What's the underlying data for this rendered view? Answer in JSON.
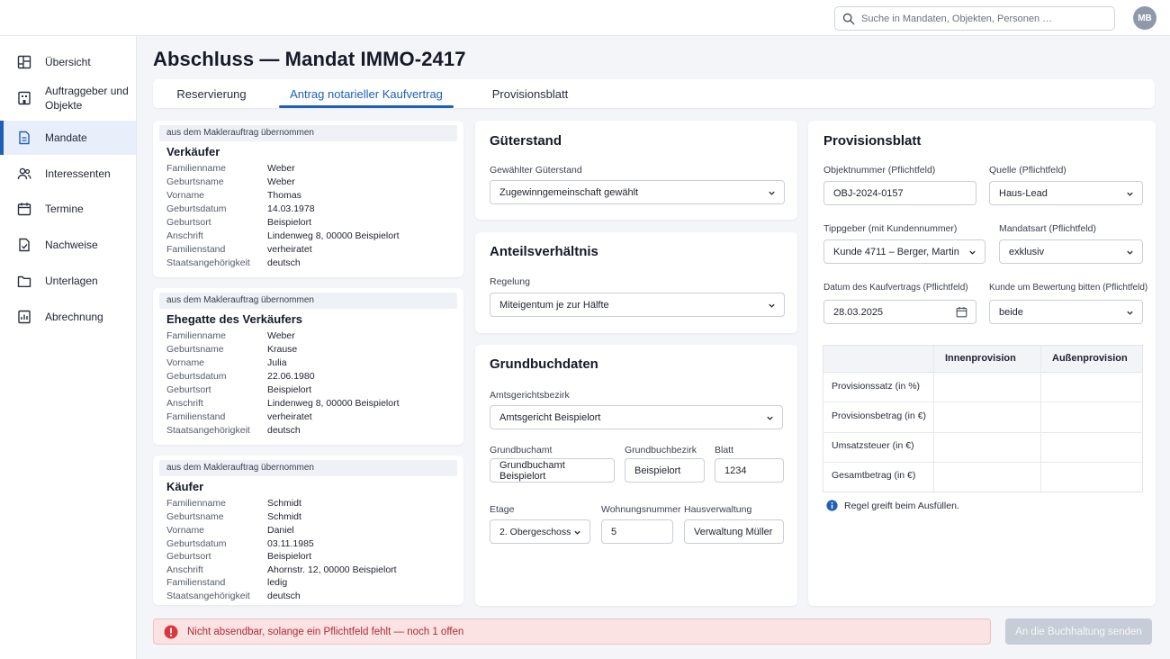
{
  "search": {
    "placeholder": "Suche in Mandaten, Objekten, Personen …"
  },
  "user": {
    "initials": "MB"
  },
  "sidebar": {
    "items": [
      {
        "label": "Übersicht",
        "icon": "grid-icon"
      },
      {
        "label": "Auftraggeber und Objekte",
        "icon": "building-icon"
      },
      {
        "label": "Mandate",
        "icon": "document-icon",
        "active": true
      },
      {
        "label": "Interessenten",
        "icon": "people-icon"
      },
      {
        "label": "Termine",
        "icon": "calendar-icon"
      },
      {
        "label": "Nachweise",
        "icon": "file-check-icon"
      },
      {
        "label": "Unterlagen",
        "icon": "folder-icon"
      },
      {
        "label": "Abrechnung",
        "icon": "receipt-icon"
      }
    ]
  },
  "page": {
    "title": "Abschluss — Mandat IMMO-2417"
  },
  "tabs": [
    {
      "label": "Reservierung"
    },
    {
      "label": "Antrag notarieller Kaufvertrag",
      "active": true
    },
    {
      "label": "Provisionsblatt"
    }
  ],
  "persons": [
    {
      "banner": "aus dem Maklerauftrag übernommen",
      "title": "Verkäufer",
      "rows": [
        [
          "Familienname",
          "Weber"
        ],
        [
          "Geburtsname",
          "Weber"
        ],
        [
          "Vorname",
          "Thomas"
        ],
        [
          "Geburtsdatum",
          "14.03.1978"
        ],
        [
          "Geburtsort",
          "Beispielort"
        ],
        [
          "Anschrift",
          "Lindenweg 8, 00000 Beispielort"
        ],
        [
          "Familienstand",
          "verheiratet"
        ],
        [
          "Staatsangehörigkeit",
          "deutsch"
        ]
      ]
    },
    {
      "banner": "aus dem Maklerauftrag übernommen",
      "title": "Ehegatte des Verkäufers",
      "rows": [
        [
          "Familienname",
          "Weber"
        ],
        [
          "Geburtsname",
          "Krause"
        ],
        [
          "Vorname",
          "Julia"
        ],
        [
          "Geburtsdatum",
          "22.06.1980"
        ],
        [
          "Geburtsort",
          "Beispielort"
        ],
        [
          "Anschrift",
          "Lindenweg 8, 00000 Beispielort"
        ],
        [
          "Familienstand",
          "verheiratet"
        ],
        [
          "Staatsangehörigkeit",
          "deutsch"
        ]
      ]
    },
    {
      "banner": "aus dem Maklerauftrag übernommen",
      "title": "Käufer",
      "rows": [
        [
          "Familienname",
          "Schmidt"
        ],
        [
          "Geburtsname",
          "Schmidt"
        ],
        [
          "Vorname",
          "Daniel"
        ],
        [
          "Geburtsdatum",
          "03.11.1985"
        ],
        [
          "Geburtsort",
          "Beispielort"
        ],
        [
          "Anschrift",
          "Ahornstr. 12, 00000 Beispielort"
        ],
        [
          "Familienstand",
          "ledig"
        ],
        [
          "Staatsangehörigkeit",
          "deutsch"
        ]
      ]
    }
  ],
  "gueterstand": {
    "title": "Güterstand",
    "label": "Gewählter Güterstand",
    "value": "Zugewinngemeinschaft gewählt"
  },
  "anteil": {
    "title": "Anteilsverhältnis",
    "label": "Regelung",
    "value": "Miteigentum je zur Hälfte"
  },
  "grundbuch": {
    "title": "Grundbuchdaten",
    "amtsgericht_label": "Amtsgerichtsbezirk",
    "amtsgericht_value": "Amtsgericht Beispielort",
    "grundbuchamt_label": "Grundbuchamt",
    "grundbuchamt_value": "Grundbuchamt Beispielort",
    "bezirk_label": "Grundbuchbezirk",
    "bezirk_value": "Beispielort",
    "blatt_label": "Blatt",
    "blatt_value": "1234",
    "etage_label": "Etage",
    "etage_value": "2. Obergeschoss",
    "wohnung_label": "Wohnungsnummer",
    "wohnung_value": "5",
    "hv_label": "Hausverwaltung",
    "hv_value": "Verwaltung Müller"
  },
  "provision": {
    "title": "Provisionsblatt",
    "objekt_label": "Objektnummer (Pflichtfeld)",
    "objekt_value": "OBJ-2024-0157",
    "quelle_label": "Quelle (Pflichtfeld)",
    "quelle_value": "Haus-Lead",
    "tipp_label": "Tippgeber (mit Kundennummer)",
    "tipp_value": "Kunde 4711 – Berger, Martin",
    "mandat_label": "Mandatsart (Pflichtfeld)",
    "mandat_value": "exklusiv",
    "datum_label": "Datum des Kaufvertrags (Pflichtfeld)",
    "datum_value": "28.03.2025",
    "bewertung_label": "Kunde um Bewertung bitten (Pflichtfeld)",
    "bewertung_value": "beide",
    "col_inner": "Innenprovision",
    "col_outer": "Außenprovision",
    "rows": [
      "Provisionssatz (in %)",
      "Provisionsbetrag (in €)",
      "Umsatzsteuer (in €)",
      "Gesamtbetrag (in €)"
    ],
    "info": "Regel greift beim Ausfüllen."
  },
  "footer": {
    "alert": "Nicht absendbar, solange ein Pflichtfeld fehlt — noch 1 offen",
    "send_label": "An die Buchhaltung senden"
  },
  "colors": {
    "accent": "#1f5fb8",
    "error": "#d9363e",
    "info": "#1f5fb8"
  }
}
